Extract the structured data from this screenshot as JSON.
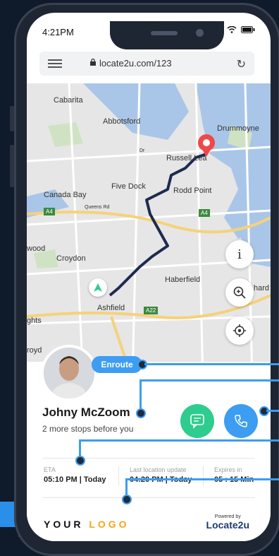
{
  "status_bar": {
    "time": "4:21PM"
  },
  "browser": {
    "url": "locate2u.com/123"
  },
  "map": {
    "labels": [
      "Cabarita",
      "Abbotsford",
      "Drummoyne",
      "Russell Lea",
      "Five Dock",
      "Rodd Point",
      "Canada Bay",
      "Croydon",
      "Haberfield",
      "Ashfield",
      "Queens Rd",
      "Dr",
      "wood",
      "ghts",
      "royd",
      "hard"
    ],
    "route_badges": [
      "A4",
      "A4",
      "A22"
    ]
  },
  "driver": {
    "status": "Enroute",
    "name": "Johny McZoom",
    "subtitle": "2 more stops before you"
  },
  "eta": {
    "label": "ETA",
    "value": "05:10 PM | Today"
  },
  "last_update": {
    "label": "Last location update",
    "value": "04:20 PM | Today"
  },
  "expires": {
    "label": "Expires in",
    "value": "05 : 15 Min"
  },
  "footer": {
    "logo_part1": "YOUR",
    "logo_part2": "LOGO",
    "powered_by": "Powered by",
    "brand": "Locate2u"
  },
  "colors": {
    "accent": "#3c9df2",
    "chat": "#2ecc8f",
    "logo_accent": "#f3a71a",
    "route": "#1d2b4f",
    "pin": "#f04848"
  }
}
